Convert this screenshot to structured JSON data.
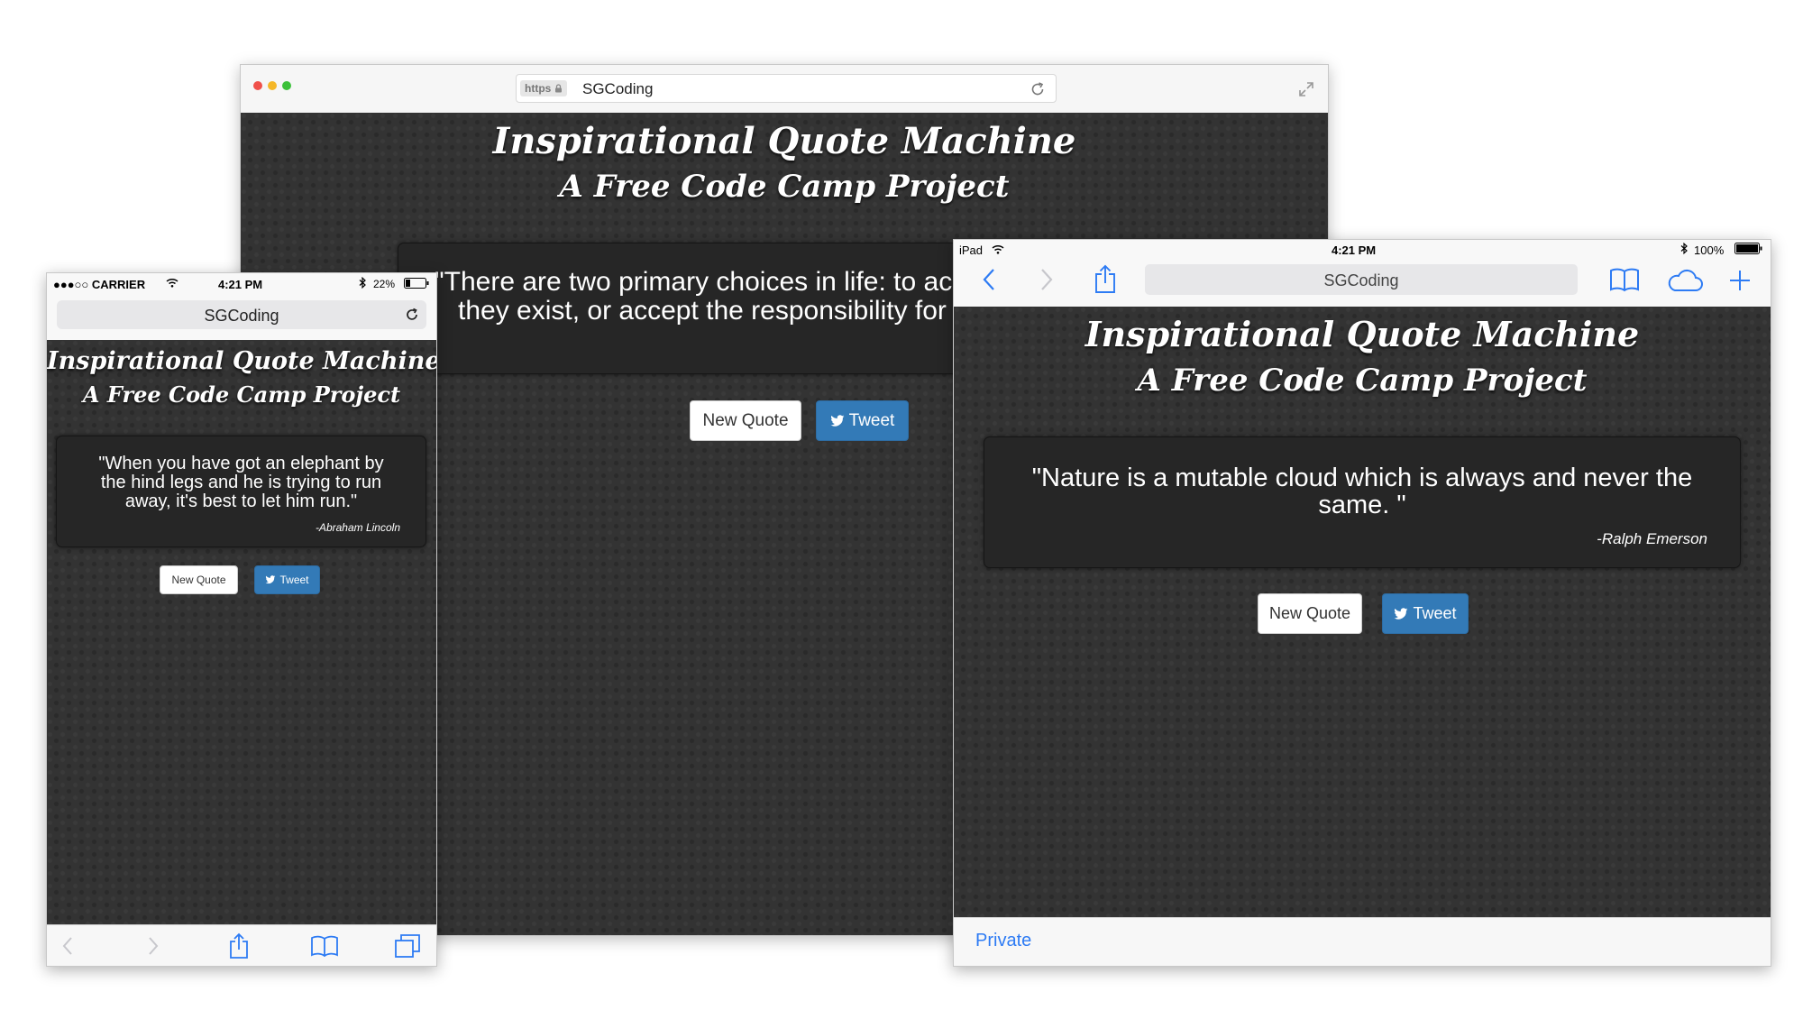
{
  "desktop": {
    "url_scheme": "https",
    "url_text": "SGCoding",
    "title": "Inspirational Quote Machine",
    "subtitle": "A Free Code Camp Project",
    "quote_line1": "\"There are two primary choices in life: to acc",
    "quote_line2": "they exist, or accept the responsibility for c",
    "new_quote_label": "New Quote",
    "tweet_label": "Tweet",
    "traffic_colors": [
      "#f0504a",
      "#f5b728",
      "#3cc13a"
    ]
  },
  "phone": {
    "carrier": "●●●○○ CARRIER",
    "time": "4:21 PM",
    "battery": "22%",
    "url_text": "SGCoding",
    "title": "Inspirational Quote Machine",
    "subtitle": "A Free Code Camp Project",
    "quote": "\"When you have got an elephant by the hind legs and he is trying to run away, it's best to let him run.\"",
    "author": "-Abraham Lincoln",
    "new_quote_label": "New Quote",
    "tweet_label": "Tweet"
  },
  "tablet": {
    "device": "iPad",
    "time": "4:21 PM",
    "battery": "100%",
    "url_text": "SGCoding",
    "title": "Inspirational Quote Machine",
    "subtitle": "A Free Code Camp Project",
    "quote": "\"Nature is a mutable cloud which is always and never the same. \"",
    "author": "-Ralph Emerson",
    "new_quote_label": "New Quote",
    "tweet_label": "Tweet",
    "private_label": "Private"
  },
  "colors": {
    "ios_blue": "#2d7bf4",
    "button_blue": "#337ab7",
    "page_dark": "#333333"
  },
  "icons": {
    "desktop": [
      "lock-icon",
      "reload-icon",
      "fullscreen-icon"
    ],
    "phone": [
      "wifi-icon",
      "bluetooth-icon",
      "battery-icon",
      "reload-icon",
      "back-icon",
      "forward-icon",
      "share-icon",
      "bookmarks-icon",
      "tabs-icon"
    ],
    "tablet": [
      "wifi-icon",
      "bluetooth-icon",
      "battery-icon",
      "back-icon",
      "forward-icon",
      "share-icon",
      "bookmarks-icon",
      "cloud-tabs-icon",
      "new-tab-icon"
    ],
    "buttons": [
      "twitter-bird-icon"
    ]
  }
}
